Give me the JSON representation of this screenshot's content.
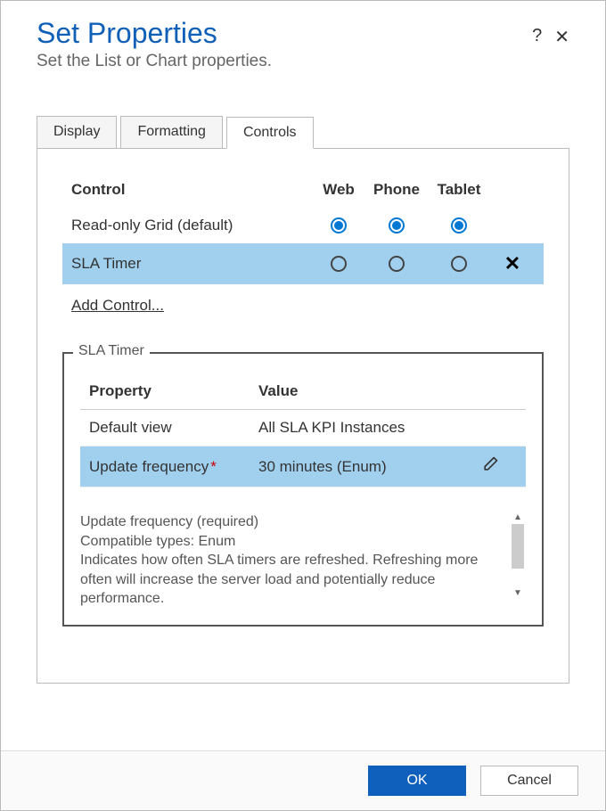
{
  "header": {
    "title": "Set Properties",
    "subtitle": "Set the List or Chart properties.",
    "help_icon": "?",
    "close_icon": "✕"
  },
  "tabs": {
    "0": {
      "label": "Display"
    },
    "1": {
      "label": "Formatting"
    },
    "2": {
      "label": "Controls"
    }
  },
  "controls_table": {
    "headers": {
      "control": "Control",
      "web": "Web",
      "phone": "Phone",
      "tablet": "Tablet"
    },
    "rows": {
      "0": {
        "name": "Read-only Grid (default)"
      },
      "1": {
        "name": "SLA Timer"
      }
    },
    "add_control_label": "Add Control..."
  },
  "detail": {
    "legend": "SLA Timer",
    "headers": {
      "property": "Property",
      "value": "Value"
    },
    "rows": {
      "0": {
        "property": "Default view",
        "value": "All SLA KPI Instances"
      },
      "1": {
        "property": "Update frequency",
        "required_mark": "*",
        "value": "30 minutes (Enum)"
      }
    },
    "help": {
      "line1": "Update frequency (required)",
      "line2": "Compatible types: Enum",
      "line3": "Indicates how often SLA timers are refreshed. Refreshing more often will increase the server load and potentially reduce performance."
    }
  },
  "footer": {
    "ok_label": "OK",
    "cancel_label": "Cancel"
  }
}
